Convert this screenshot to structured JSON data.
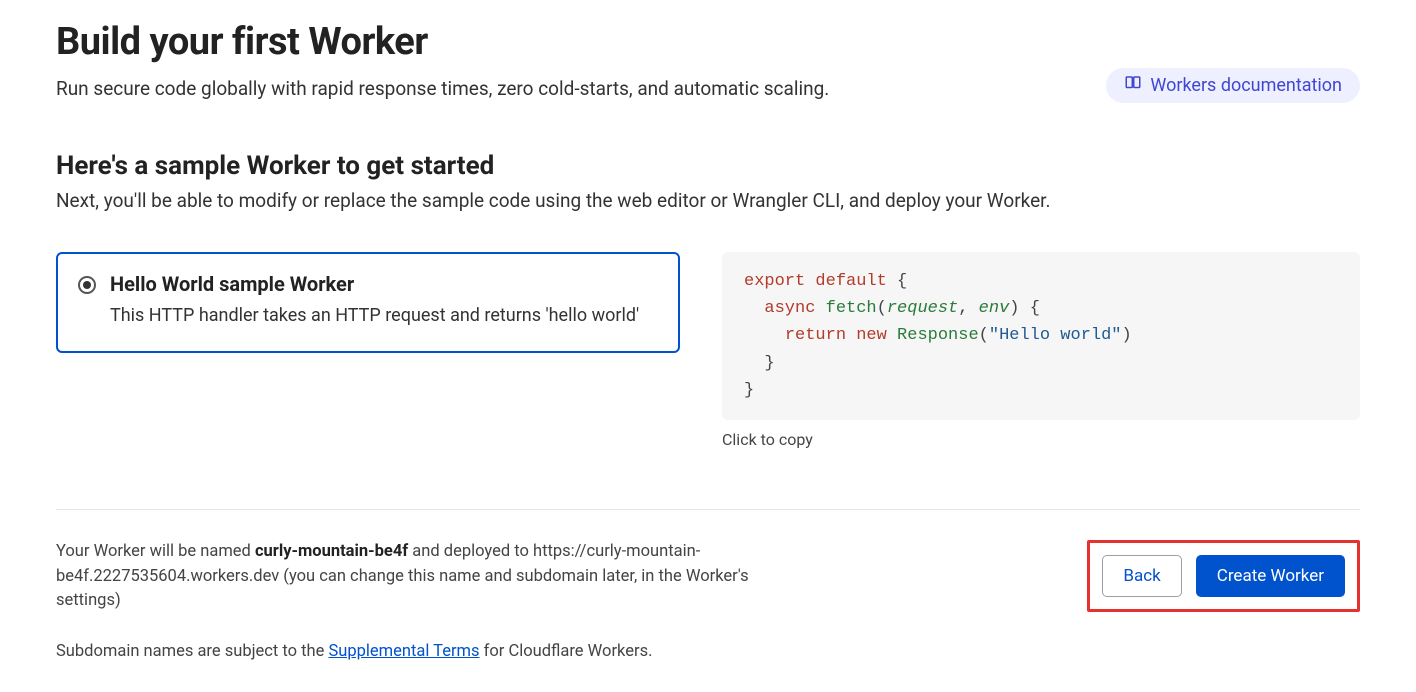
{
  "header": {
    "title": "Build your first Worker",
    "subtitle": "Run secure code globally with rapid response times, zero cold-starts, and automatic scaling.",
    "docs_link_label": "Workers documentation"
  },
  "sample": {
    "heading": "Here's a sample Worker to get started",
    "sub": "Next, you'll be able to modify or replace the sample code using the web editor or Wrangler CLI, and deploy your Worker.",
    "option": {
      "title": "Hello World sample Worker",
      "desc": "This HTTP handler takes an HTTP request and returns 'hello world'",
      "selected": true
    },
    "code": {
      "kw_export": "export",
      "kw_default": "default",
      "kw_async": "async",
      "fn_fetch": "fetch",
      "arg_request": "request",
      "arg_env": "env",
      "kw_return": "return",
      "kw_new": "new",
      "type_response": "Response",
      "str_hello": "\"Hello world\"",
      "brace_open": "{",
      "brace_close": "}",
      "paren_open": "(",
      "paren_close": ")",
      "comma": ","
    },
    "click_to_copy": "Click to copy"
  },
  "footer": {
    "text_prefix": "Your Worker will be named ",
    "worker_name": "curly-mountain-be4f",
    "text_mid": " and deployed to https://curly-mountain-be4f.2227535604.workers.dev (you can change this name and subdomain later, in the Worker's settings)",
    "back_label": "Back",
    "create_label": "Create Worker",
    "legal_prefix": "Subdomain names are subject to the ",
    "legal_link": "Supplemental Terms",
    "legal_suffix": " for Cloudflare Workers."
  }
}
